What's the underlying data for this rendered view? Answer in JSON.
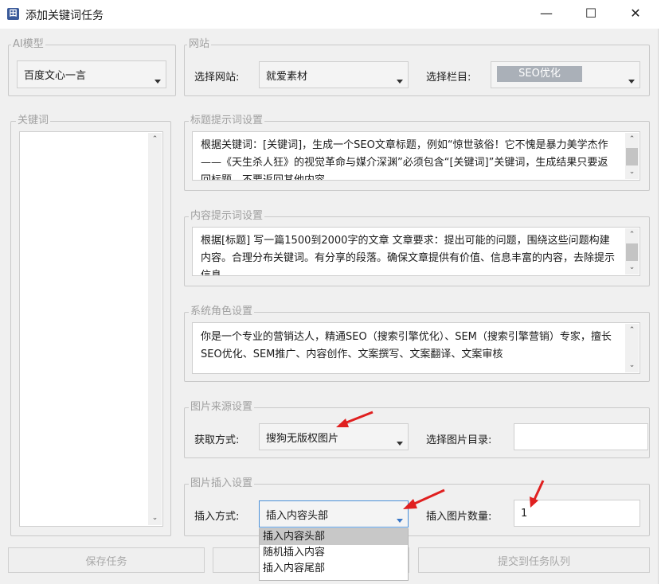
{
  "window": {
    "title": "添加关键词任务",
    "icon": "app-icon",
    "controls": [
      "minimize-icon",
      "maximize-icon",
      "close-icon"
    ]
  },
  "ai_model": {
    "legend": "AI模型",
    "selected": "百度文心一言"
  },
  "website": {
    "legend": "网站",
    "site_label": "选择网站:",
    "site_value": "就爱素材",
    "column_label": "选择栏目:",
    "column_value": "SEO优化"
  },
  "keywords": {
    "legend": "关键词"
  },
  "title_prompt": {
    "legend": "标题提示词设置",
    "text": "根据关键词：[关键词]，生成一个SEO文章标题，例如“惊世骇俗！它不愧是暴力美学杰作——《天生杀人狂》的视觉革命与媒介深渊”必须包含“[关键词]”关键词，生成结果只要返回标题，不要返回其他内容"
  },
  "content_prompt": {
    "legend": "内容提示词设置",
    "text": "根据[标题] 写一篇1500到2000字的文章 文章要求：提出可能的问题，围绕这些问题构建内容。合理分布关键词。有分享的段落。确保文章提供有价值、信息丰富的内容，去除提示信息"
  },
  "system_role": {
    "legend": "系统角色设置",
    "text": "你是一个专业的营销达人，精通SEO（搜索引擎优化）、SEM（搜索引擎营销）专家，擅长SEO优化、SEM推广、内容创作、文案撰写、文案翻译、文案审核"
  },
  "image_source": {
    "legend": "图片来源设置",
    "method_label": "获取方式:",
    "method_value": "搜狗无版权图片",
    "dir_label": "选择图片目录:",
    "dir_value": ""
  },
  "image_insert": {
    "legend": "图片插入设置",
    "mode_label": "插入方式:",
    "mode_value": "插入内容头部",
    "count_label": "插入图片数量:",
    "count_value": "1",
    "options": [
      "插入内容头部",
      "随机插入内容",
      "插入内容尾部"
    ]
  },
  "buttons": {
    "save": "保存任务",
    "submit": "提交到任务队列"
  },
  "colors": {
    "annotation_arrow": "#e02020",
    "selected_option": "#c8c8c8",
    "column_highlight": "#aab0b8"
  }
}
